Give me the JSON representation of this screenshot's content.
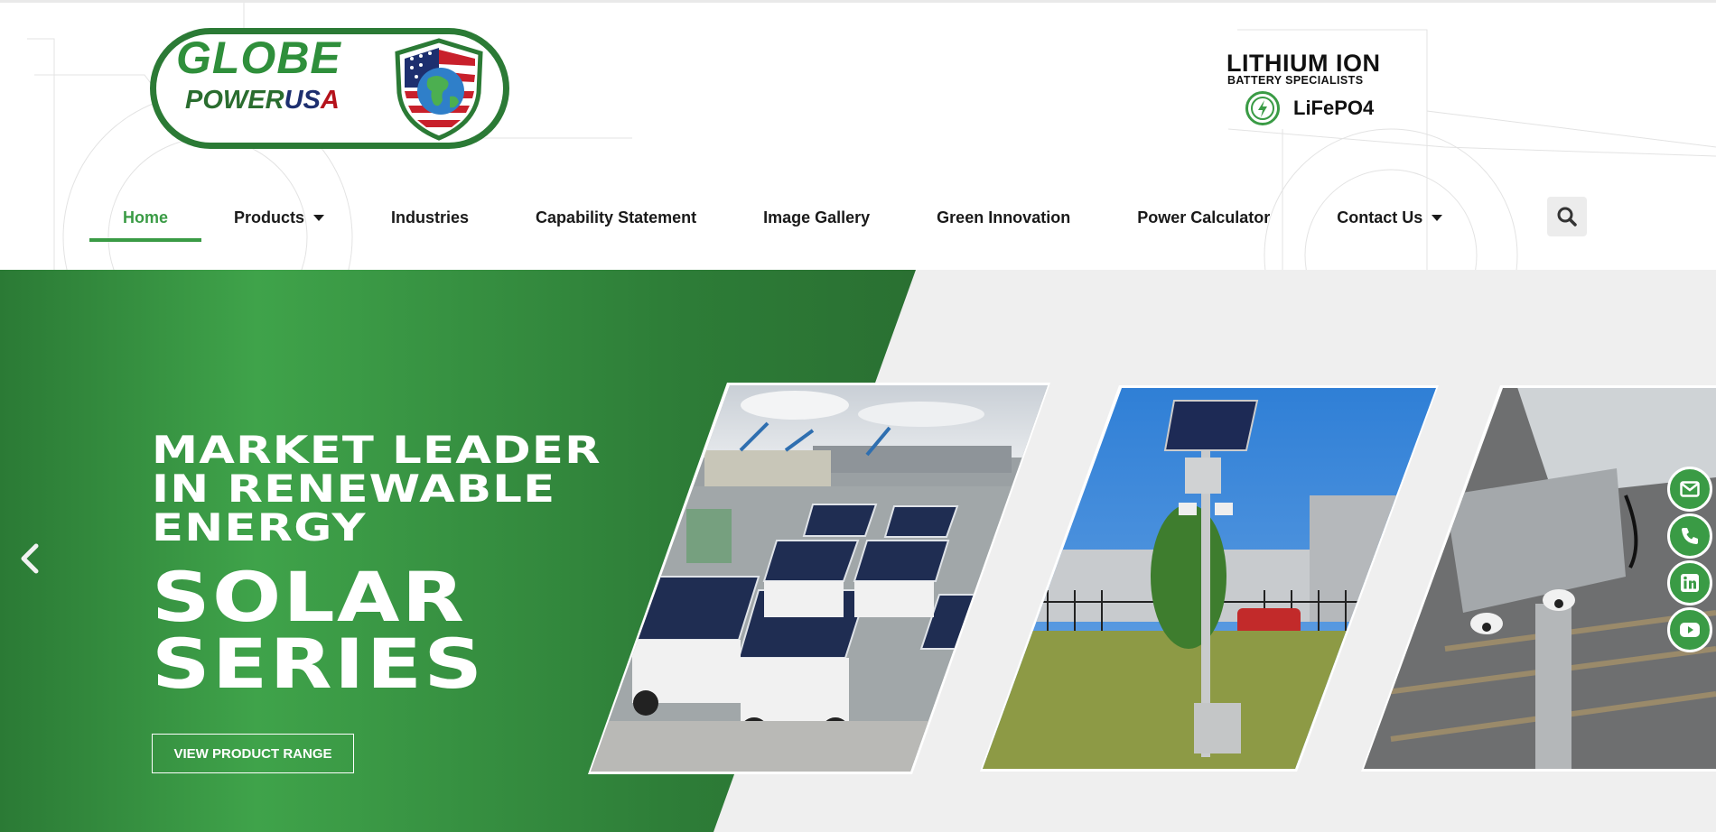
{
  "brand": {
    "logo_line1": "GLOBE",
    "logo_line2_power": "POWER",
    "logo_line2_us": "US",
    "logo_line2_a": "A",
    "badge_title": "LITHIUM ION",
    "badge_subtitle": "BATTERY SPECIALISTS",
    "badge_chemistry": "LiFePO4",
    "primary_color": "#3a9b45",
    "dark_green": "#2b7a35"
  },
  "nav": {
    "items": [
      {
        "label": "Home",
        "active": true,
        "dropdown": false
      },
      {
        "label": "Products",
        "active": false,
        "dropdown": true
      },
      {
        "label": "Industries",
        "active": false,
        "dropdown": false
      },
      {
        "label": "Capability Statement",
        "active": false,
        "dropdown": false
      },
      {
        "label": "Image Gallery",
        "active": false,
        "dropdown": false
      },
      {
        "label": "Green Innovation",
        "active": false,
        "dropdown": false
      },
      {
        "label": "Power Calculator",
        "active": false,
        "dropdown": false
      },
      {
        "label": "Contact Us",
        "active": false,
        "dropdown": true
      }
    ],
    "search_icon": "search-icon"
  },
  "hero": {
    "line1": "MARKET LEADER",
    "line2": "IN RENEWABLE",
    "line3": "ENERGY",
    "big1": "SOLAR",
    "big2": "SERIES",
    "cta_label": "VIEW PRODUCT RANGE",
    "prev_icon": "chevron-left-icon",
    "images": [
      "solar-trailers-photo",
      "solar-pole-photo",
      "security-camera-photo"
    ]
  },
  "social": {
    "icons": [
      "email-icon",
      "phone-icon",
      "linkedin-icon",
      "youtube-icon"
    ]
  }
}
